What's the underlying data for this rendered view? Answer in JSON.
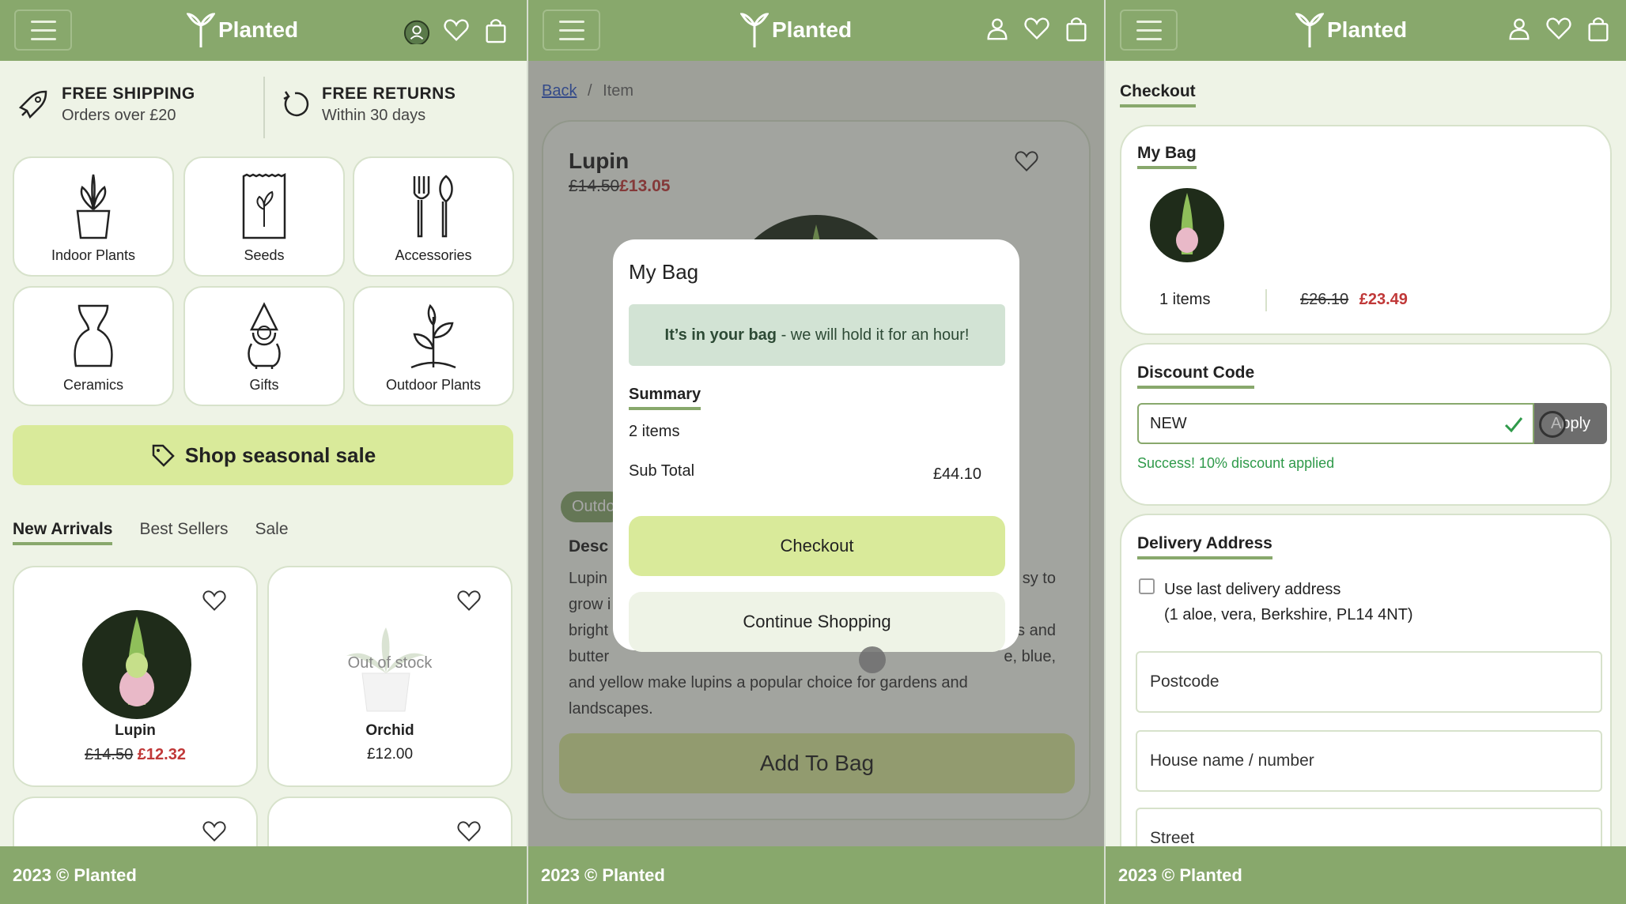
{
  "brand": {
    "name": "Planted",
    "accent": "#88a86c",
    "sale_color": "#d9ea9a",
    "price_red": "#c03838"
  },
  "footer": {
    "text": "2023 © Planted"
  },
  "panel1": {
    "benefits": [
      {
        "title": "FREE SHIPPING",
        "subtitle": "Orders over £20",
        "icon": "rocket-icon"
      },
      {
        "title": "FREE RETURNS",
        "subtitle": "Within 30 days",
        "icon": "return-arrow-icon"
      }
    ],
    "categories": [
      {
        "label": "Indoor Plants",
        "icon": "potted-plant-icon"
      },
      {
        "label": "Seeds",
        "icon": "seed-packet-icon"
      },
      {
        "label": "Accessories",
        "icon": "garden-tools-icon"
      },
      {
        "label": "Ceramics",
        "icon": "vase-icon"
      },
      {
        "label": "Gifts",
        "icon": "gnome-icon"
      },
      {
        "label": "Outdoor Plants",
        "icon": "sprout-icon"
      }
    ],
    "sale_button": "Shop seasonal sale",
    "tabs": [
      "New Arrivals",
      "Best Sellers",
      "Sale"
    ],
    "products": [
      {
        "name": "Lupin",
        "old_price": "£14.50",
        "price": "£12.32"
      },
      {
        "name": "Orchid",
        "price": "£12.00",
        "stock_label": "Out of stock"
      }
    ]
  },
  "panel2": {
    "breadcrumb": {
      "back": "Back",
      "sep": "/",
      "current": "Item"
    },
    "product": {
      "name": "Lupin",
      "old_price": "£14.50",
      "price": "£13.05"
    },
    "tag": "Outdo",
    "desc_heading": "Desc",
    "desc_lines": [
      "Lupin",
      "grow i",
      "bright",
      "butter",
      "and yellow make lupins a popular choice for gardens and",
      "landscapes."
    ],
    "desc_right": [
      "sy to",
      "es and",
      "e, blue,"
    ],
    "add_to_bag": "Add To Bag",
    "modal": {
      "title": "My Bag",
      "note_bold": "It’s in your bag",
      "note_rest": " - we will hold it for an hour!",
      "summary": "Summary",
      "items": "2 items",
      "subtotal_label": "Sub Total",
      "subtotal_value": "£44.10",
      "checkout": "Checkout",
      "continue": "Continue Shopping"
    }
  },
  "panel3": {
    "heading": "Checkout",
    "bag": {
      "title": "My Bag",
      "items": "1 items",
      "old_total": "£26.10",
      "total": "£23.49"
    },
    "discount": {
      "title": "Discount Code",
      "value": "NEW",
      "apply": "Apply",
      "message": "Success! 10% discount applied"
    },
    "delivery": {
      "title": "Delivery Address",
      "use_last": "Use last delivery address",
      "last_address": "(1 aloe, vera, Berkshire, PL14 4NT)",
      "postcode": "Postcode",
      "house": "House name / number",
      "street": "Street"
    }
  }
}
